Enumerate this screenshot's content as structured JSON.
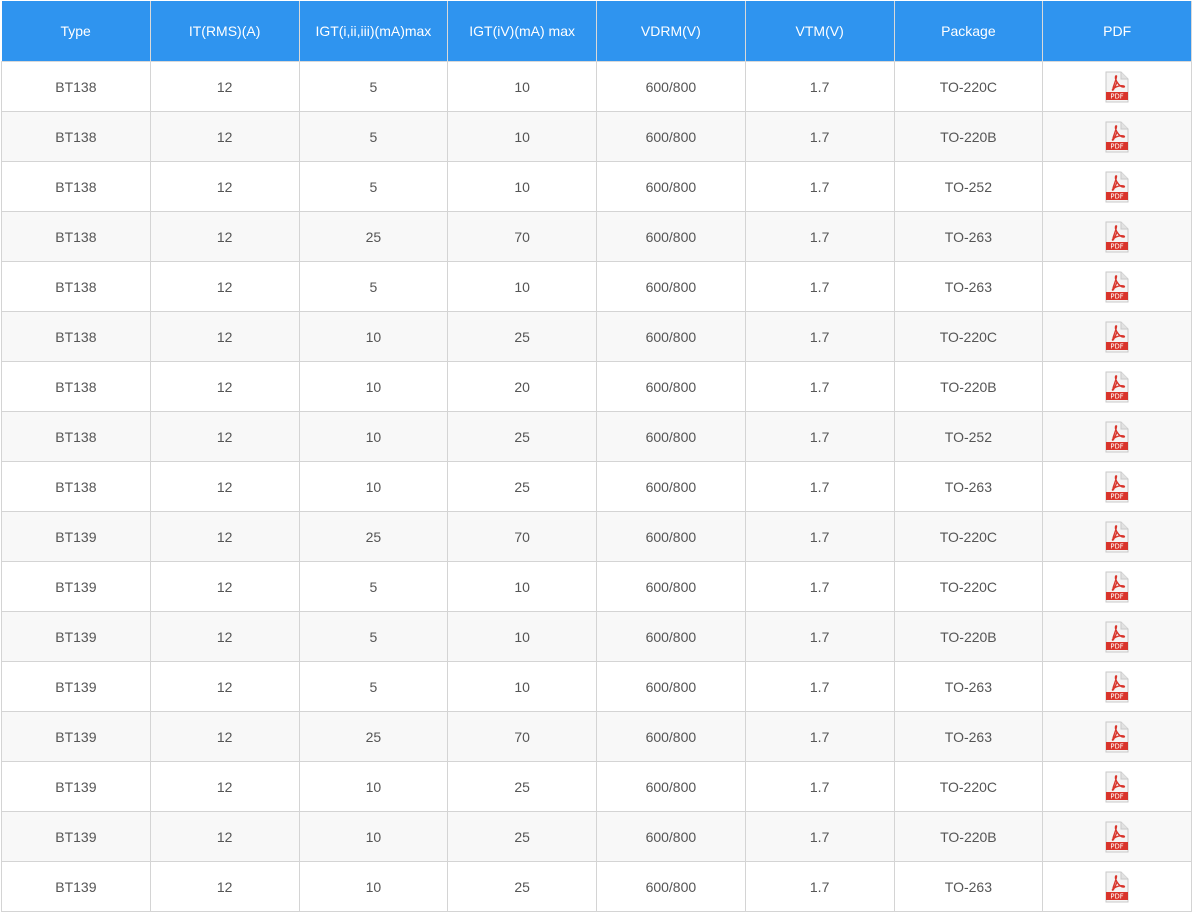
{
  "table": {
    "headers": [
      "Type",
      "IT(RMS)(A)",
      "IGT(i,ii,iii)(mA)max",
      "IGT(iV)(mA) max",
      "VDRM(V)",
      "VTM(V)",
      "Package",
      "PDF"
    ],
    "rows": [
      [
        "BT138",
        "12",
        "5",
        "10",
        "600/800",
        "1.7",
        "TO-220C"
      ],
      [
        "BT138",
        "12",
        "5",
        "10",
        "600/800",
        "1.7",
        "TO-220B"
      ],
      [
        "BT138",
        "12",
        "5",
        "10",
        "600/800",
        "1.7",
        "TO-252"
      ],
      [
        "BT138",
        "12",
        "25",
        "70",
        "600/800",
        "1.7",
        "TO-263"
      ],
      [
        "BT138",
        "12",
        "5",
        "10",
        "600/800",
        "1.7",
        "TO-263"
      ],
      [
        "BT138",
        "12",
        "10",
        "25",
        "600/800",
        "1.7",
        "TO-220C"
      ],
      [
        "BT138",
        "12",
        "10",
        "20",
        "600/800",
        "1.7",
        "TO-220B"
      ],
      [
        "BT138",
        "12",
        "10",
        "25",
        "600/800",
        "1.7",
        "TO-252"
      ],
      [
        "BT138",
        "12",
        "10",
        "25",
        "600/800",
        "1.7",
        "TO-263"
      ],
      [
        "BT139",
        "12",
        "25",
        "70",
        "600/800",
        "1.7",
        "TO-220C"
      ],
      [
        "BT139",
        "12",
        "5",
        "10",
        "600/800",
        "1.7",
        "TO-220C"
      ],
      [
        "BT139",
        "12",
        "5",
        "10",
        "600/800",
        "1.7",
        "TO-220B"
      ],
      [
        "BT139",
        "12",
        "5",
        "10",
        "600/800",
        "1.7",
        "TO-263"
      ],
      [
        "BT139",
        "12",
        "25",
        "70",
        "600/800",
        "1.7",
        "TO-263"
      ],
      [
        "BT139",
        "12",
        "10",
        "25",
        "600/800",
        "1.7",
        "TO-220C"
      ],
      [
        "BT139",
        "12",
        "10",
        "25",
        "600/800",
        "1.7",
        "TO-220B"
      ],
      [
        "BT139",
        "12",
        "10",
        "25",
        "600/800",
        "1.7",
        "TO-263"
      ]
    ],
    "pdf_icon": {
      "name": "pdf-icon",
      "label": "PDF"
    }
  },
  "colors": {
    "header_bg": "#2f94ef",
    "header_text": "#ffffff",
    "row_alt_bg": "#f8f8f8",
    "cell_text": "#555555",
    "pdf_red": "#d9342b"
  }
}
